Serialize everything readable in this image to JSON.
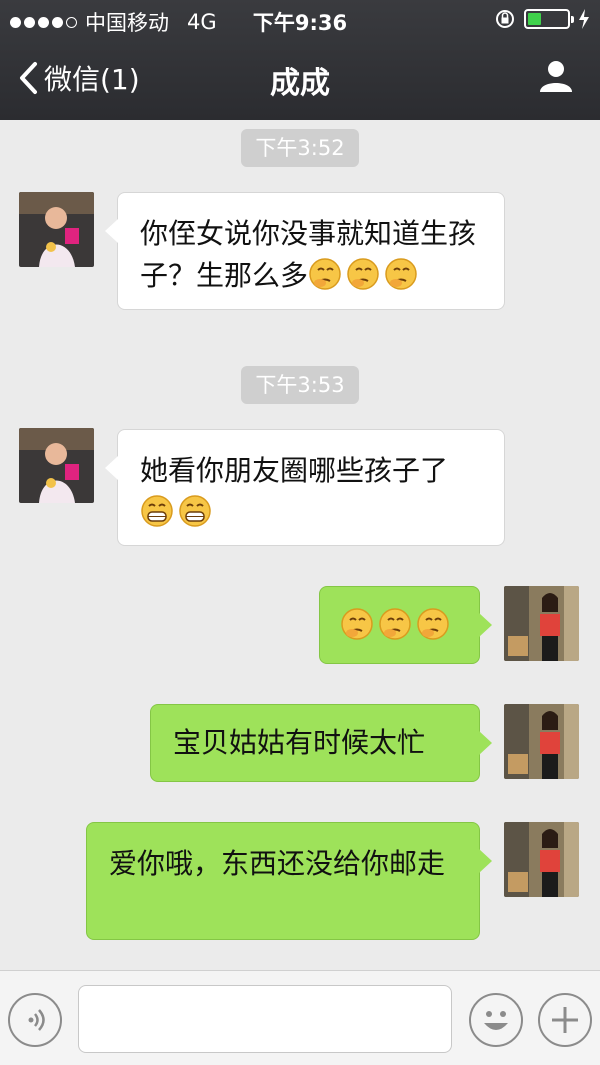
{
  "status_bar": {
    "carrier": "中国移动",
    "network": "4G",
    "time": "下午9:36",
    "signal_bars": 4,
    "battery_level": 0.35
  },
  "nav": {
    "back_label": "微信(1)",
    "title": "成成"
  },
  "messages": [
    {
      "timestamp": "下午3:52"
    },
    {
      "side": "incoming",
      "text": "你侄女说你没事就知道生孩子？生那么多",
      "emojis": [
        "thinking-emoji",
        "thinking-emoji",
        "thinking-emoji"
      ]
    },
    {
      "timestamp": "下午3:53"
    },
    {
      "side": "incoming",
      "text": "她看你朋友圈哪些孩子了",
      "emojis": [
        "grin-emoji",
        "grin-emoji"
      ]
    },
    {
      "side": "outgoing",
      "text": "",
      "emojis": [
        "thinking-emoji",
        "thinking-emoji",
        "thinking-emoji"
      ]
    },
    {
      "side": "outgoing",
      "text": "宝贝姑姑有时候太忙"
    },
    {
      "side": "outgoing",
      "text": "爱你哦，东西还没给你邮走"
    }
  ],
  "input": {
    "placeholder": ""
  },
  "colors": {
    "outgoing_bubble": "#9ee25a",
    "incoming_bubble": "#ffffff",
    "background": "#ebebeb",
    "nav_background": "#2b2c30"
  },
  "icons": [
    "back-chevron-icon",
    "profile-icon",
    "voice-icon",
    "emoji-icon",
    "plus-icon",
    "lock-rotation-icon",
    "charging-icon"
  ]
}
